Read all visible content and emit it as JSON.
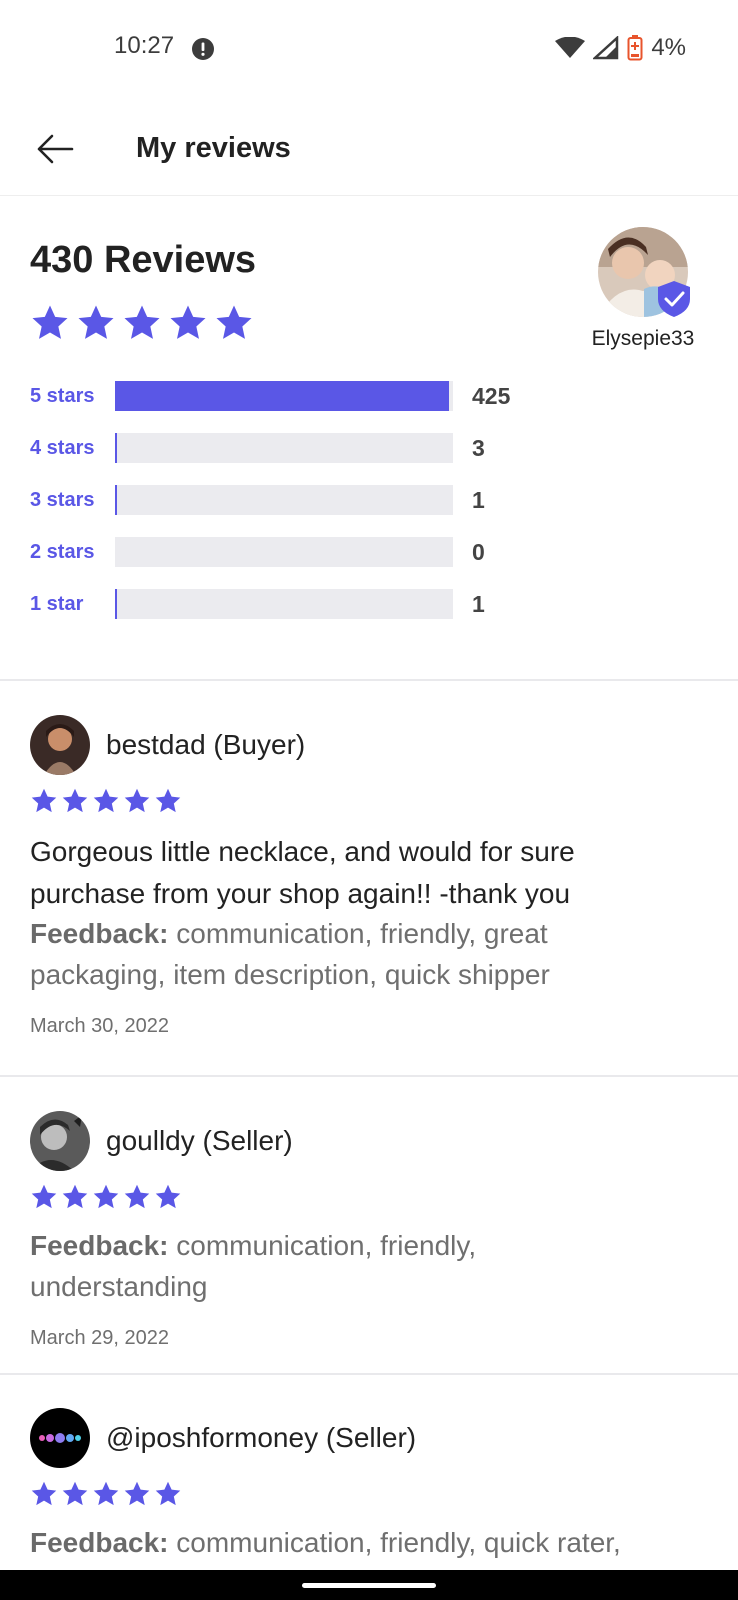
{
  "status_bar": {
    "time": "10:27",
    "battery_percent": "4%"
  },
  "header": {
    "title": "My reviews"
  },
  "summary": {
    "title": "430 Reviews",
    "rating_stars": 5,
    "profile_name": "Elysepie33",
    "accent_color": "#5a57e6",
    "breakdown": [
      {
        "label": "5 stars",
        "count": "425",
        "fraction": 0.988
      },
      {
        "label": "4 stars",
        "count": "3",
        "fraction": 0.007
      },
      {
        "label": "3 stars",
        "count": "1",
        "fraction": 0.002
      },
      {
        "label": "2 stars",
        "count": "0",
        "fraction": 0
      },
      {
        "label": "1 star",
        "count": "1",
        "fraction": 0.002
      }
    ]
  },
  "reviews": [
    {
      "name": "bestdad (Buyer)",
      "stars": 5,
      "text_line1": "Gorgeous little necklace, and would for sure",
      "text_line2": "purchase from your shop again!! -thank you",
      "feedback_label": "Feedback:",
      "feedback_line1": " communication, friendly, great",
      "feedback_line2": "packaging, item description, quick shipper",
      "date": "March 30, 2022"
    },
    {
      "name": "goulldy (Seller)",
      "stars": 5,
      "feedback_label": "Feedback:",
      "feedback_line1": " communication, friendly,",
      "feedback_line2": "understanding",
      "date": "March 29, 2022"
    },
    {
      "name": "@iposhformoney (Seller)",
      "stars": 5,
      "feedback_label": "Feedback:",
      "feedback_line1": " communication, friendly, quick rater,"
    }
  ]
}
